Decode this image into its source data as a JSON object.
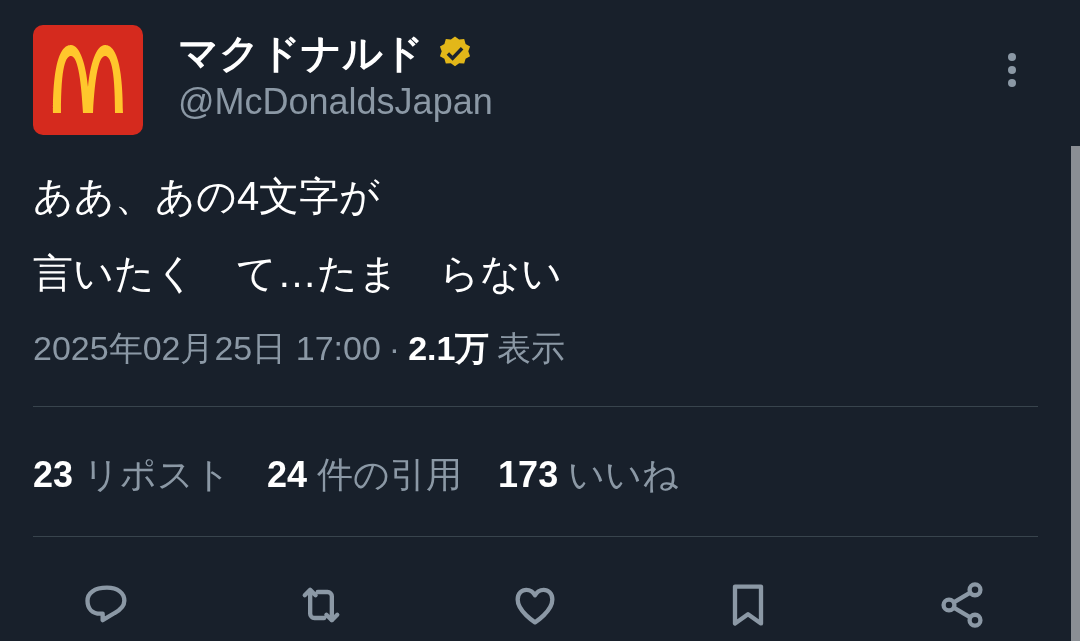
{
  "author": {
    "name": "マクドナルド",
    "handle": "@McDonaldsJapan",
    "verified": true
  },
  "text_lines": [
    "ああ、あの4文字が",
    "言いたく　て…たま　らない"
  ],
  "meta": {
    "time": "2025年02月25日 17:00",
    "separator": "·",
    "views": "2.1万",
    "views_label": "表示"
  },
  "stats": [
    {
      "count": "23",
      "label": "リポスト"
    },
    {
      "count": "24",
      "label": "件の引用"
    },
    {
      "count": "173",
      "label": "いいね"
    }
  ]
}
